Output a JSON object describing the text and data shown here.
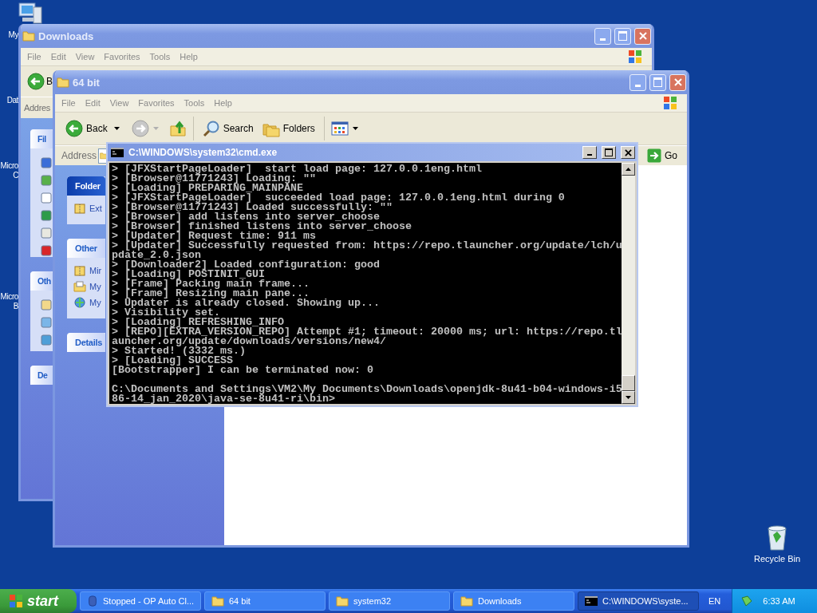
{
  "desktop": {
    "icons": [
      {
        "lines": [
          "My"
        ]
      },
      {
        "lines": [
          "Dat"
        ]
      },
      {
        "lines": [
          "Micro",
          "C"
        ]
      },
      {
        "lines": [
          "Micro",
          "B"
        ]
      }
    ],
    "recycle_bin": {
      "label": "Recycle Bin"
    }
  },
  "downloads_window": {
    "title": "Downloads",
    "menu": [
      "File",
      "Edit",
      "View",
      "Favorites",
      "Tools",
      "Help"
    ],
    "back_label": "B",
    "address_label": "Addres",
    "panels": [
      {
        "title": "Fil"
      },
      {
        "title": "Oth"
      },
      {
        "title": "De"
      }
    ]
  },
  "folder_window": {
    "title": "64 bit",
    "menu": [
      "File",
      "Edit",
      "View",
      "Favorites",
      "Tools",
      "Help"
    ],
    "toolbar": {
      "back": "Back",
      "search": "Search",
      "folders": "Folders"
    },
    "address_label": "Address",
    "go": "Go",
    "panels": [
      {
        "title": "Folder",
        "items": [
          {
            "label": "Ext",
            "kind": "zip"
          }
        ]
      },
      {
        "title": "Other",
        "items": [
          {
            "label": "Mir",
            "kind": "zip"
          },
          {
            "label": "My",
            "kind": "documents"
          },
          {
            "label": "My",
            "kind": "network"
          }
        ]
      },
      {
        "title": "Details"
      }
    ]
  },
  "console_window": {
    "title": "C:\\WINDOWS\\system32\\cmd.exe",
    "lines": [
      "> [JFXStartPageLoader]  start load page: 127.0.0.1eng.html",
      "> [Browser@11771243] Loading: \"\"",
      "> [Loading] PREPARING_MAINPANE",
      "> [JFXStartPageLoader]  succeeded load page: 127.0.0.1eng.html during 0",
      "> [Browser@11771243] Loaded successfully: \"\"",
      "> [Browser] add listens into server_choose",
      "> [Browser] finished listens into server_choose",
      "> [Updater] Request time: 911 ms",
      "> [Updater] Successfully requested from: https://repo.tlauncher.org/update/lch/u",
      "pdate_2.0.json",
      "> [Downloader2] Loaded configuration: good",
      "> [Loading] POSTINIT_GUI",
      "> [Frame] Packing main frame...",
      "> [Frame] Resizing main pane...",
      "> Updater is already closed. Showing up...",
      "> Visibility set.",
      "> [Loading] REFRESHING_INFO",
      "> [REPO][EXTRA_VERSION_REPO] Attempt #1; timeout: 20000 ms; url: https://repo.tl",
      "auncher.org/update/downloads/versions/new4/",
      "> Started! (3332 ms.)",
      "> [Loading] SUCCESS",
      "[Bootstrapper] I can be terminated now: 0"
    ],
    "prompt_lines": [
      "C:\\Documents and Settings\\VM2\\My Documents\\Downloads\\openjdk-8u41-b04-windows-i5",
      "86-14_jan_2020\\java-se-8u41-ri\\bin>"
    ]
  },
  "taskbar": {
    "start": "start",
    "items": [
      {
        "label": "Stopped - OP Auto Cl...",
        "kind": "app",
        "selected": false
      },
      {
        "label": "64 bit",
        "kind": "folder",
        "selected": false
      },
      {
        "label": "system32",
        "kind": "folder",
        "selected": false
      },
      {
        "label": "Downloads",
        "kind": "folder",
        "selected": false
      },
      {
        "label": "C:\\WINDOWS\\syste...",
        "kind": "console",
        "selected": true
      }
    ],
    "language": "EN",
    "clock": "6:33 AM"
  }
}
